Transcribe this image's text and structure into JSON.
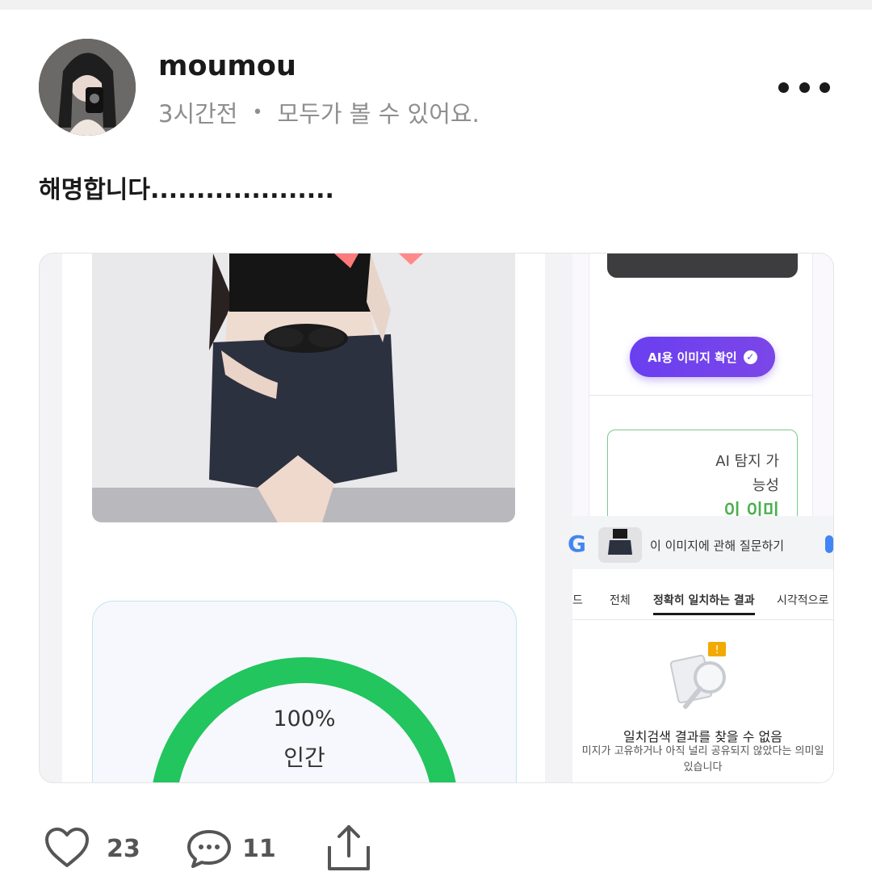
{
  "post": {
    "username": "moumou",
    "time": "3시간전",
    "separator": "•",
    "visibility": "모두가 볼 수 있어요.",
    "text": "해명합니다...................."
  },
  "left_card": {
    "gauge_percent_label": "100%",
    "gauge_label": "인간",
    "gauge_fill_fraction": 1.0,
    "gauge_color": "#22c55e"
  },
  "right_card": {
    "ai_button_label": "AI용 이미지 확인",
    "detect_line1": "AI 탐지 가",
    "detect_line2": "능성",
    "detect_result": "이 이미",
    "google": {
      "logo": "G",
      "query_label": "이 이미지에 관해 질문하기",
      "tabs": [
        "드",
        "전체",
        "정확히 일치하는 결과",
        "시각적으로"
      ],
      "active_tab": "정확히 일치하는 결과",
      "empty_title": "일치검색 결과를 찾을 수 없음",
      "empty_sub_line1": "미지가 고유하거나 아직 널리 공유되지 않았다는 의미일",
      "empty_sub_line2": "있습니다"
    }
  },
  "actions": {
    "likes": "23",
    "comments": "11"
  },
  "colors": {
    "accent_purple": "#6a3ff0",
    "success_green": "#4caf50",
    "meta_gray": "#8e8e8e"
  }
}
